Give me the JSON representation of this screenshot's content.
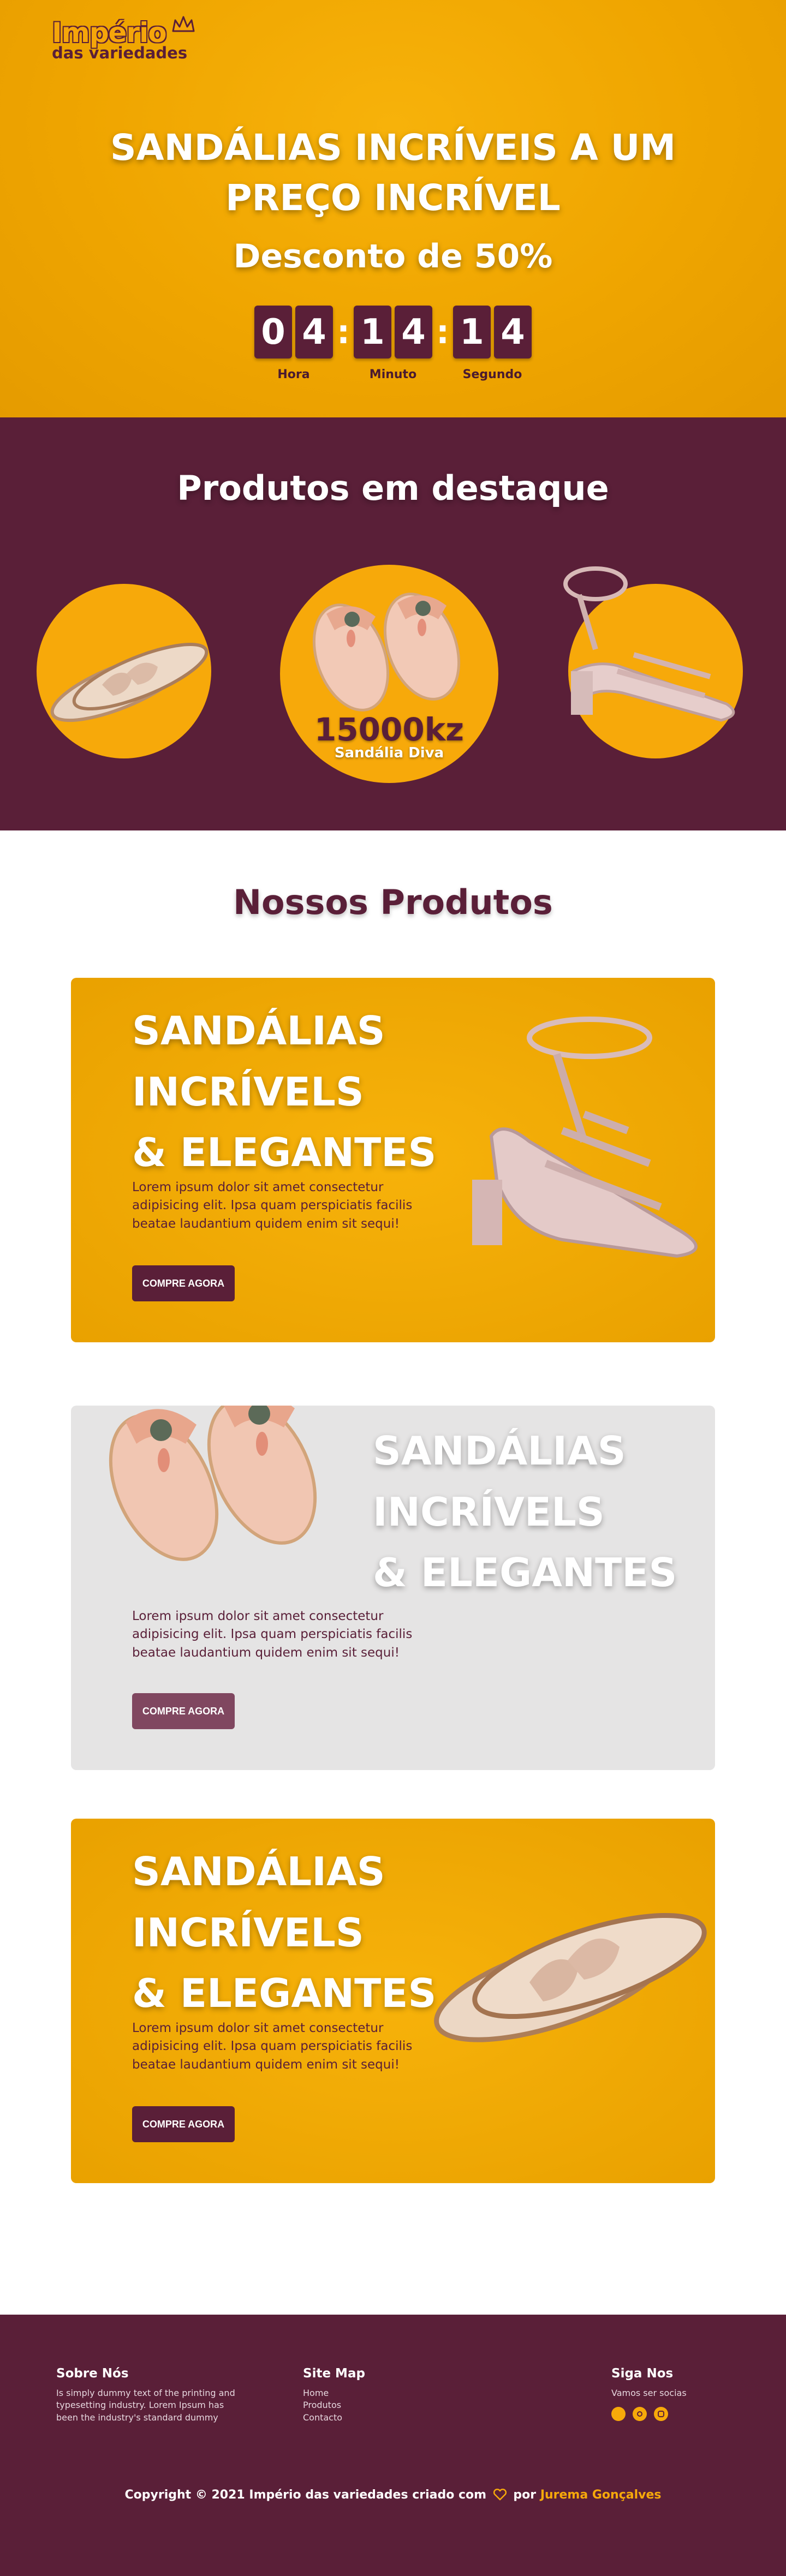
{
  "header": {
    "logo_line1": "Império",
    "logo_line2": "das variedades"
  },
  "hero": {
    "title_line1": "SANDÁLIAS INCRÍVEIS A UM",
    "title_line2": "PREÇO INCRÍVEL",
    "subtitle": "Desconto de 50%",
    "countdown": {
      "hours": [
        "0",
        "4"
      ],
      "minutes": [
        "1",
        "4"
      ],
      "seconds": [
        "1",
        "4"
      ],
      "separator": ":",
      "label_hours": "Hora",
      "label_minutes": "Minuto",
      "label_seconds": "Segundo"
    }
  },
  "featured": {
    "heading": "Produtos em destaque",
    "active_price": "15000kz",
    "active_name": "Sandália Diva"
  },
  "products": {
    "heading": "Nossos Produtos",
    "cards": [
      {
        "title_l1": "SANDÁLIAS",
        "title_l2": "INCRÍVELS",
        "title_l3": "& ELEGANTES",
        "desc_l1": "Lorem ipsum dolor sit amet consectetur",
        "desc_l2": "adipisicing elit. Ipsa quam perspiciatis facilis",
        "desc_l3": "beatae laudantium quidem enim sit sequi!",
        "button": "COMPRE AGORA"
      },
      {
        "title_l1": "SANDÁLIAS",
        "title_l2": "INCRÍVELS",
        "title_l3": "& ELEGANTES",
        "desc_l1": "Lorem ipsum dolor sit amet consectetur",
        "desc_l2": "adipisicing elit. Ipsa quam perspiciatis facilis",
        "desc_l3": "beatae laudantium quidem enim sit sequi!",
        "button": "COMPRE AGORA"
      },
      {
        "title_l1": "SANDÁLIAS",
        "title_l2": "INCRÍVELS",
        "title_l3": "& ELEGANTES",
        "desc_l1": "Lorem ipsum dolor sit amet consectetur",
        "desc_l2": "adipisicing elit. Ipsa quam perspiciatis facilis",
        "desc_l3": "beatae laudantium quidem enim sit sequi!",
        "button": "COMPRE AGORA"
      }
    ]
  },
  "footer": {
    "about_title": "Sobre Nós",
    "about_l1": "Is simply dummy text of the printing and",
    "about_l2": "typesetting industry. Lorem Ipsum has",
    "about_l3": "been the industry's standard dummy",
    "sitemap_title": "Site Map",
    "sitemap_links": [
      "Home",
      "Produtos",
      "Contacto"
    ],
    "follow_title": "Siga Nos",
    "follow_text": "Vamos ser socias",
    "copyright_prefix": "Copyright © 2021 Império das variedades criado com",
    "copyright_by": "por",
    "copyright_author": "Jurema Gonçalves"
  },
  "colors": {
    "brand_gold": "#f7a90a",
    "brand_wine": "#5a1f38",
    "card_grey": "#e5e4e4"
  },
  "icons": [
    "crown-icon",
    "heart-icon",
    "social-icon"
  ]
}
